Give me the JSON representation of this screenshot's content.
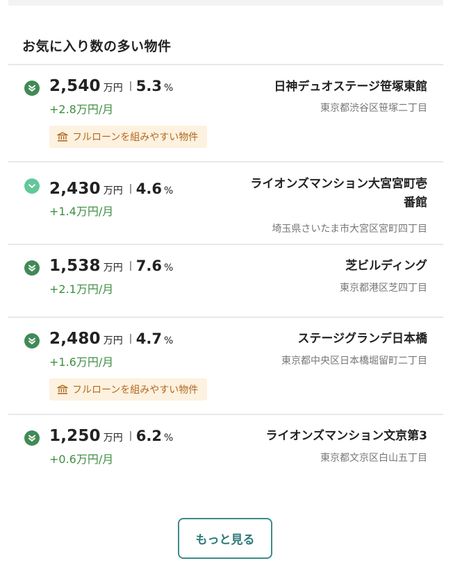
{
  "section": {
    "title": "お気に入り数の多い物件"
  },
  "colors": {
    "status_dark": "#3f8a55",
    "status_light": "#62c79a",
    "change_text": "#3e8e41",
    "tag_bg": "#fdf1df",
    "tag_text": "#b06a22",
    "button_border": "#3d8b88"
  },
  "listings": [
    {
      "status_icon": "double-chevron-down-icon",
      "price": "2,540",
      "price_unit": "万円",
      "yield": "5.3",
      "yield_unit": "%",
      "change": "+2.8万円/月",
      "name": "日神デュオステージ笹塚東館",
      "address": "東京都渋谷区笹塚二丁目",
      "tag": "フルローンを組みやすい物件",
      "tag_icon": "bank-icon"
    },
    {
      "status_icon": "chevron-down-icon",
      "price": "2,430",
      "price_unit": "万円",
      "yield": "4.6",
      "yield_unit": "%",
      "change": "+1.4万円/月",
      "name": "ライオンズマンション大宮宮町壱番館",
      "address": "埼玉県さいたま市大宮区宮町四丁目"
    },
    {
      "status_icon": "double-chevron-down-icon",
      "price": "1,538",
      "price_unit": "万円",
      "yield": "7.6",
      "yield_unit": "%",
      "change": "+2.1万円/月",
      "name": "芝ビルディング",
      "address": "東京都港区芝四丁目"
    },
    {
      "status_icon": "double-chevron-down-icon",
      "price": "2,480",
      "price_unit": "万円",
      "yield": "4.7",
      "yield_unit": "%",
      "change": "+1.6万円/月",
      "name": "ステージグランデ日本橋",
      "address": "東京都中央区日本橋堀留町二丁目",
      "tag": "フルローンを組みやすい物件",
      "tag_icon": "bank-icon"
    },
    {
      "status_icon": "double-chevron-down-icon",
      "price": "1,250",
      "price_unit": "万円",
      "yield": "6.2",
      "yield_unit": "%",
      "change": "+0.6万円/月",
      "name": "ライオンズマンション文京第3",
      "address": "東京都文京区白山五丁目"
    }
  ],
  "more_button": {
    "label": "もっと見る"
  }
}
